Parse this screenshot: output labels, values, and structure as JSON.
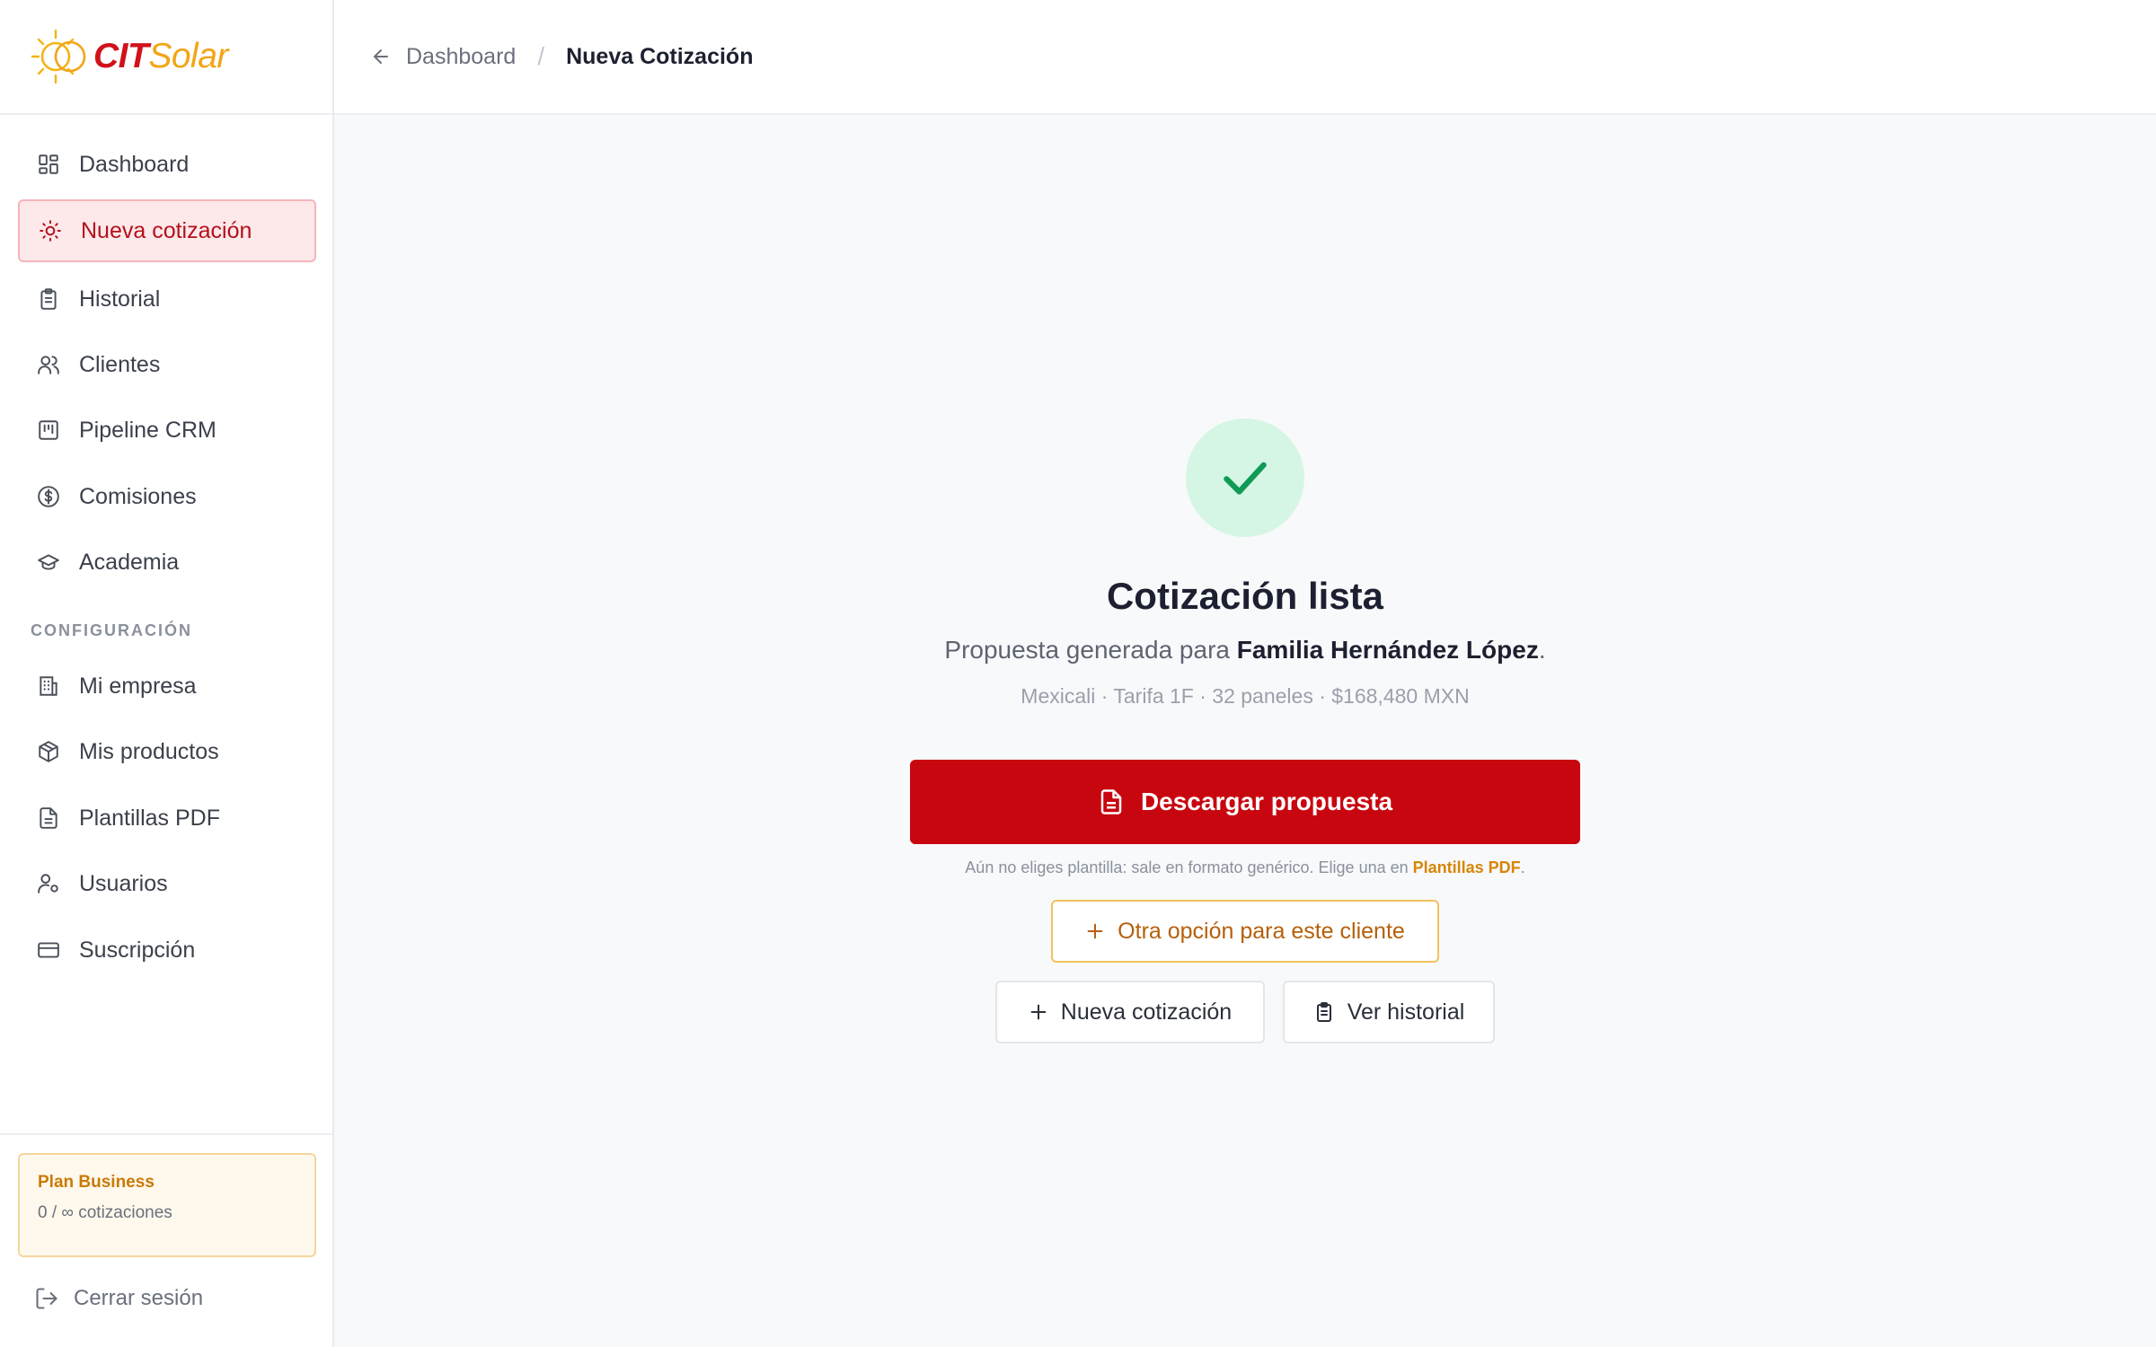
{
  "brand": {
    "part1": "CIT",
    "part2": "Solar",
    "red": "#d0121b",
    "amber": "#f2a516"
  },
  "header": {
    "back_label": "Dashboard",
    "separator": "/",
    "current": "Nueva Cotización"
  },
  "sidebar": {
    "items": [
      {
        "label": "Dashboard",
        "icon": "grid-icon"
      },
      {
        "label": "Nueva cotización",
        "icon": "sun-icon",
        "active": true
      },
      {
        "label": "Historial",
        "icon": "clipboard-icon"
      },
      {
        "label": "Clientes",
        "icon": "users-icon"
      },
      {
        "label": "Pipeline CRM",
        "icon": "kanban-icon"
      },
      {
        "label": "Comisiones",
        "icon": "dollar-circle-icon"
      },
      {
        "label": "Academia",
        "icon": "graduation-cap-icon"
      }
    ],
    "section_label": "CONFIGURACIÓN",
    "config_items": [
      {
        "label": "Mi empresa",
        "icon": "building-icon"
      },
      {
        "label": "Mis productos",
        "icon": "package-icon"
      },
      {
        "label": "Plantillas PDF",
        "icon": "file-text-icon"
      },
      {
        "label": "Usuarios",
        "icon": "user-cog-icon"
      },
      {
        "label": "Suscripción",
        "icon": "credit-card-icon"
      }
    ],
    "plan": {
      "title": "Plan Business",
      "usage": "0 / ∞ cotizaciones"
    },
    "logout_label": "Cerrar sesión"
  },
  "result": {
    "title": "Cotización lista",
    "subtitle_prefix": "Propuesta generada para ",
    "client_name": "Familia Hernández López",
    "subtitle_suffix": ".",
    "meta": "Mexicali · Tarifa 1F · 32 paneles · $168,480 MXN",
    "download_label": "Descargar propuesta",
    "hint_text": "Aún no eliges plantilla: sale en formato genérico. Elige una en ",
    "hint_link": "Plantillas PDF",
    "hint_end": ".",
    "other_option_label": "Otra opción para este cliente",
    "new_quote_label": "Nueva cotización",
    "history_label": "Ver historial"
  },
  "colors": {
    "primary": "#c8060f",
    "success_bg": "#d5f6e4",
    "success": "#0f9a56",
    "accent_amber": "#d68606"
  }
}
